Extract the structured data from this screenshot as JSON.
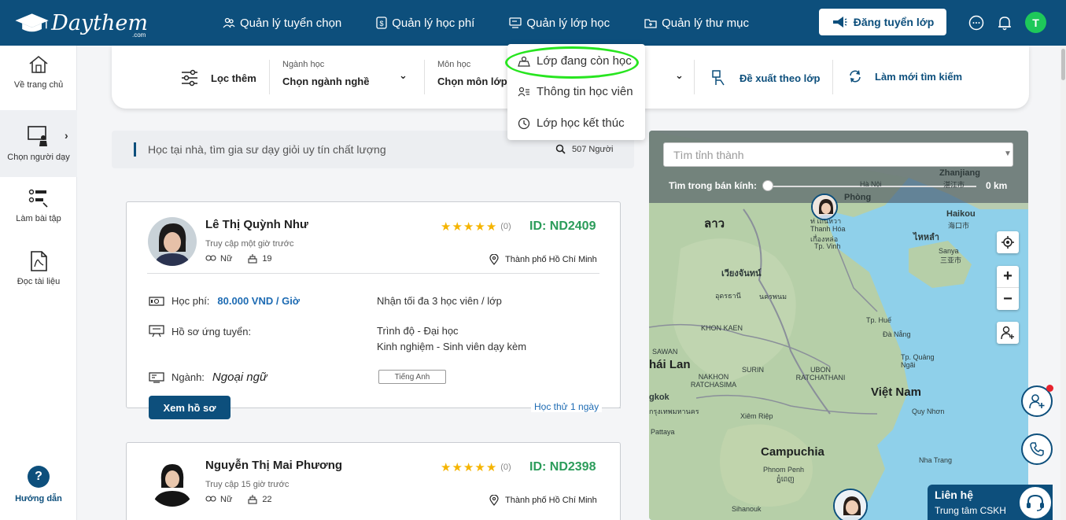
{
  "brand": {
    "name": "Daythem",
    "suffix": ".com"
  },
  "nav": [
    {
      "label": "Quản lý tuyển chọn",
      "icon": "people-icon"
    },
    {
      "label": "Quản lý học phí",
      "icon": "dollar-icon"
    },
    {
      "label": "Quản lý lớp học",
      "icon": "classroom-icon"
    },
    {
      "label": "Quản lý thư mục",
      "icon": "folder-icon"
    }
  ],
  "post_button": "Đăng tuyển lớp",
  "user_initial": "T",
  "sidebar": [
    {
      "label": "Về trang chủ",
      "icon": "home-icon"
    },
    {
      "label": "Chọn người dạy",
      "icon": "teacher-icon",
      "active": true
    },
    {
      "label": "Làm bài tập",
      "icon": "assignment-icon"
    },
    {
      "label": "Đọc tài liệu",
      "icon": "pdf-icon"
    }
  ],
  "help_label": "Hướng dẫn",
  "filters": {
    "more": "Lọc thêm",
    "major_label": "Ngành học",
    "major_value": "Chọn ngành nghề",
    "subject_label": "Môn học",
    "subject_value": "Chọn môn lớp",
    "suggest": "Đề xuất theo lớp",
    "refresh": "Làm mới tìm kiếm"
  },
  "dropdown": [
    {
      "label": "Lớp đang còn học",
      "icon": "class-active-icon"
    },
    {
      "label": "Thông tin học viên",
      "icon": "student-info-icon"
    },
    {
      "label": "Lớp học kết thúc",
      "icon": "clock-icon"
    }
  ],
  "search": {
    "text": "Học tại nhà, tìm gia sư dạy giỏi uy tín chất lượng",
    "count": "507 Người"
  },
  "tutors": [
    {
      "name": "Lê Thị Quỳnh Như",
      "access": "Truy cập một giờ trước",
      "gender": "Nữ",
      "age": "19",
      "reviews": "(0)",
      "id": "ID: ND2409",
      "location": "Thành phố Hồ Chí Minh",
      "fee_label": "Học phí:",
      "fee_value": "80.000 VND / Giờ",
      "capacity": "Nhận tối đa 3 học viên / lớp",
      "profile_label": "Hồ sơ ứng tuyển:",
      "level": "Trình độ - Đại học",
      "experience": "Kinh nghiệm - Sinh viên dạy kèm",
      "major_label": "Ngành:",
      "major_value": "Ngoại ngữ",
      "tag": "Tiếng Anh",
      "view_button": "Xem hồ sơ",
      "trial": "Học thử 1 ngày"
    },
    {
      "name": "Nguyễn Thị Mai Phương",
      "access": "Truy cập 15 giờ trước",
      "gender": "Nữ",
      "age": "22",
      "reviews": "(0)",
      "id": "ID: ND2398",
      "location": "Thành phố Hồ Chí Minh"
    }
  ],
  "map": {
    "search_placeholder": "Tìm tỉnh thành",
    "radius_label": "Tìm trong bán kính:",
    "radius_value": "0 km",
    "labels": [
      "ลาว",
      "Thanh Hóa",
      "ท่ เถ็นหวา",
      "เกื่องหล่อ",
      "Tp. Vinh",
      "Haikou",
      "海口市",
      "ไหหลำ",
      "Sanya",
      "三亚市",
      "เวียงจันทน์",
      "อุดรธานี",
      "นครพนม",
      "KHON KAEN",
      "SAWAN",
      "hái Lan",
      "NAKHON RATCHASIMA",
      "SURIN",
      "UBON RATCHATHANI",
      "Tp. Huế",
      "Đà Nẵng",
      "Việt Nam",
      "Tp. Quảng Ngãi",
      "Quy Nhơn",
      "Campuchia",
      "Phnom Penh",
      "ភ្នំពេញ",
      "Nha Trang",
      "Xiêm Riệp",
      "gkok",
      "กรุงเทพมหานคร",
      "Pattaya",
      "Hà Nội",
      "Phòng",
      "Zhanjiang",
      "湛江市",
      "Sihanouk"
    ]
  },
  "contact": {
    "title": "Liên hệ",
    "subtitle": "Trung tâm CSKH"
  },
  "colors": {
    "primary": "#0d4f7c",
    "accent_green": "#2b9c5a",
    "star": "#f5b400",
    "highlight": "#27e51f"
  }
}
